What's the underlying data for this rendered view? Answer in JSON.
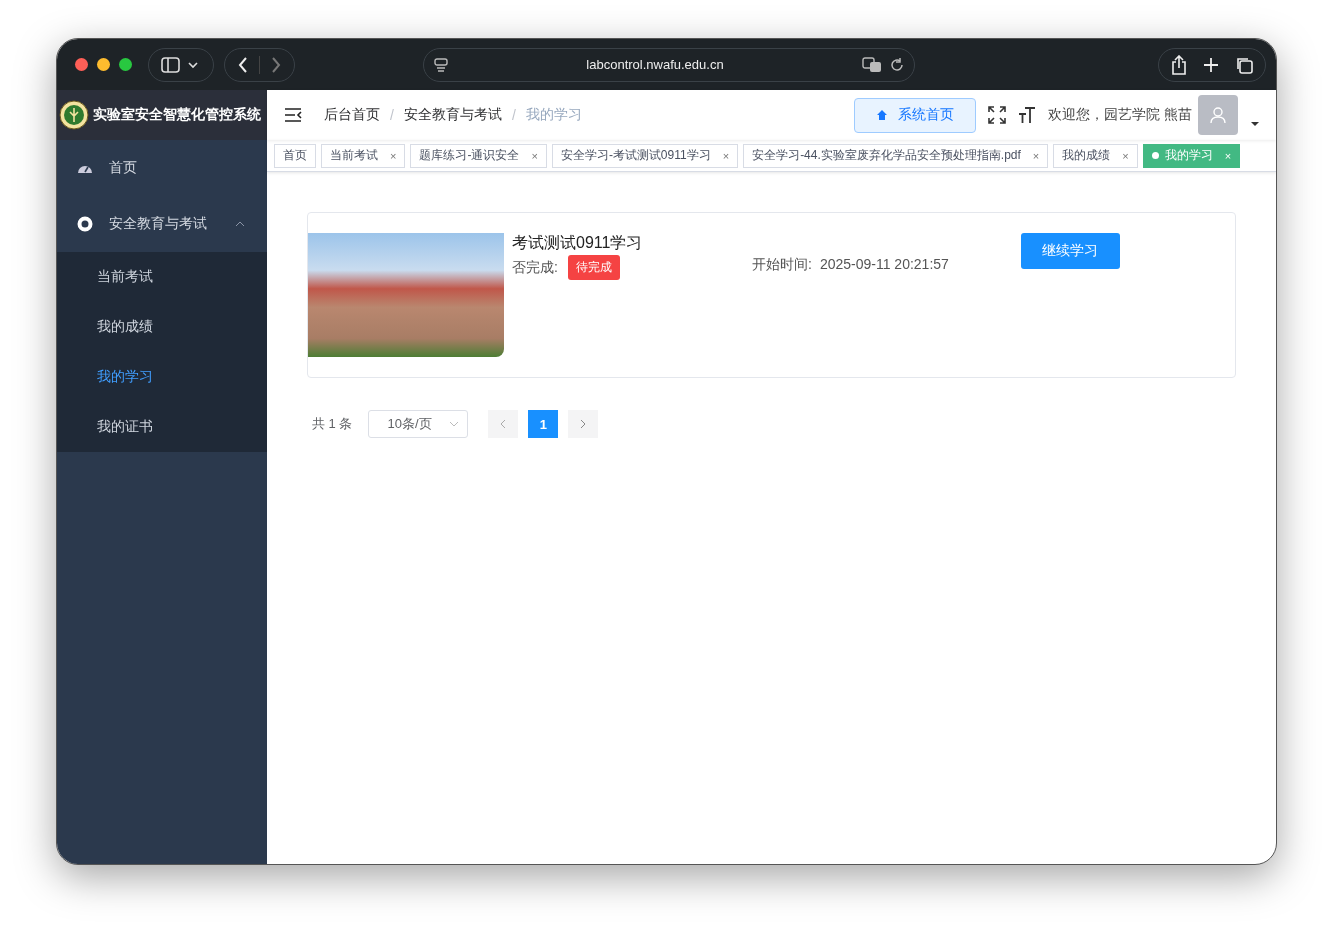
{
  "browser": {
    "url": "labcontrol.nwafu.edu.cn"
  },
  "app_title": "实验室安全智慧化管控系统",
  "sidebar": [
    {
      "label": "首页",
      "selected": false
    },
    {
      "label": "安全教育与考试",
      "expanded": true,
      "selected": false,
      "children": [
        {
          "label": "当前考试",
          "selected": false
        },
        {
          "label": "我的成绩",
          "selected": false
        },
        {
          "label": "我的学习",
          "selected": true
        },
        {
          "label": "我的证书",
          "selected": false
        }
      ]
    }
  ],
  "breadcrumbs": [
    {
      "label": "后台首页",
      "current": false
    },
    {
      "separator": "/",
      "label": "安全教育与考试",
      "current": false
    },
    {
      "separator": "/",
      "label": "我的学习",
      "current": true
    }
  ],
  "home_button": "系统首页",
  "welcome": "欢迎您，园艺学院 熊苗",
  "tabs": [
    {
      "label": "首页",
      "selected": false
    },
    {
      "label": "当前考试",
      "close": "×",
      "selected": false
    },
    {
      "label": "题库练习-通识安全",
      "close": "×",
      "selected": false
    },
    {
      "label": "安全学习-考试测试0911学习",
      "close": "×",
      "selected": false
    },
    {
      "label": "安全学习-44.实验室废弃化学品安全预处理指南.pdf",
      "close": "×",
      "selected": false
    },
    {
      "label": "我的成绩",
      "close": "×",
      "selected": false
    },
    {
      "label": "我的学习",
      "close": "×",
      "selected": true
    }
  ],
  "courses": [
    {
      "title": "考试测试0911学习",
      "status_label": "否完成:",
      "status": "待完成",
      "done": false,
      "start_label": "开始时间:",
      "start_time": "2025-09-11 20:21:57",
      "button": "继续学习"
    }
  ],
  "pagination": {
    "total": "共 1 条",
    "page_size": "10条/页",
    "pages": [
      {
        "label": "1",
        "selected": true
      }
    ]
  }
}
